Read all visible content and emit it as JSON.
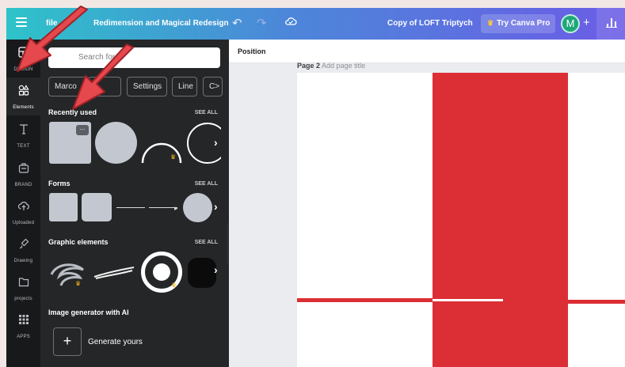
{
  "topbar": {
    "file_label": "file",
    "resize_label": "Redimension and Magical Redesign",
    "doc_title": "Copy of LOFT Triptych",
    "pro_label": "Try Canva Pro",
    "avatar_initial": "M"
  },
  "rail": {
    "items": [
      {
        "label": "DESIGN"
      },
      {
        "label": "Elements"
      },
      {
        "label": "TEXT"
      },
      {
        "label": "BRAND"
      },
      {
        "label": "Uploaded"
      },
      {
        "label": "Drawing"
      },
      {
        "label": "projects"
      },
      {
        "label": "APPS"
      }
    ]
  },
  "panel": {
    "search_placeholder": "Search for",
    "chips": [
      "Marco",
      "",
      "Settings",
      "Line",
      "C>"
    ],
    "sections": [
      {
        "title": "Recently used",
        "see_all": "SEE ALL"
      },
      {
        "title": "Forms",
        "see_all": "SEE ALL"
      },
      {
        "title": "Graphic elements",
        "see_all": "SEE ALL"
      },
      {
        "title": "Image generator with AI"
      }
    ],
    "generate_label": "Generate yours"
  },
  "editor": {
    "context_label": "Position",
    "page_label": "Page 2",
    "page_title_placeholder": "Add page title"
  },
  "colors": {
    "accent_red": "#dc2e35",
    "arrow_red": "#e5484d",
    "panel_bg": "#252627",
    "rail_bg": "#18191b"
  },
  "icons": [
    "hamburger-icon",
    "undo-icon",
    "redo-icon",
    "cloud-icon",
    "crown-icon",
    "plus-icon",
    "share-chart-icon",
    "chevron-right-icon",
    "more-icon"
  ]
}
